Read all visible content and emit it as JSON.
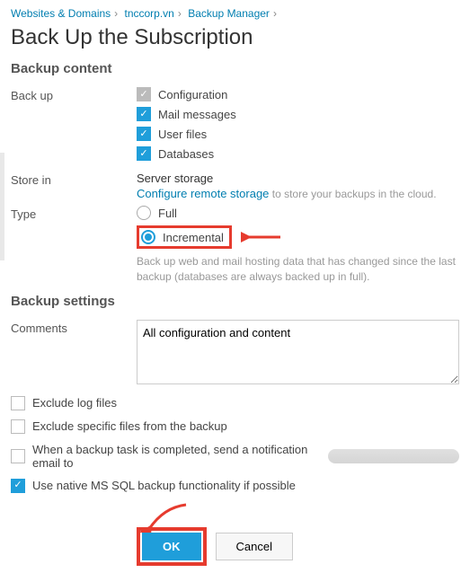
{
  "breadcrumb": {
    "items": [
      "Websites & Domains",
      "tnccorp.vn",
      "Backup Manager"
    ]
  },
  "title": "Back Up the Subscription",
  "sections": {
    "content_heading": "Backup content",
    "settings_heading": "Backup settings"
  },
  "backup": {
    "label": "Back up",
    "options": {
      "config": {
        "label": "Configuration",
        "checked": true,
        "style": "grey"
      },
      "mail": {
        "label": "Mail messages",
        "checked": true
      },
      "files": {
        "label": "User files",
        "checked": true
      },
      "db": {
        "label": "Databases",
        "checked": true
      }
    }
  },
  "store": {
    "label": "Store in",
    "title": "Server storage",
    "link": "Configure remote storage",
    "hint": " to store your backups in the cloud."
  },
  "type": {
    "label": "Type",
    "full": "Full",
    "incremental": "Incremental",
    "selected": "incremental",
    "desc": "Back up web and mail hosting data that has changed since the last backup (databases are always backed up in full)."
  },
  "comments": {
    "label": "Comments",
    "value": "All configuration and content"
  },
  "options": {
    "exclude_logs": {
      "label": "Exclude log files",
      "checked": false
    },
    "exclude_files": {
      "label": "Exclude specific files from the backup",
      "checked": false
    },
    "notify": {
      "label": "When a backup task is completed, send a notification email to",
      "checked": false
    },
    "mssql": {
      "label": "Use native MS SQL backup functionality if possible",
      "checked": true
    }
  },
  "buttons": {
    "ok": "OK",
    "cancel": "Cancel"
  }
}
